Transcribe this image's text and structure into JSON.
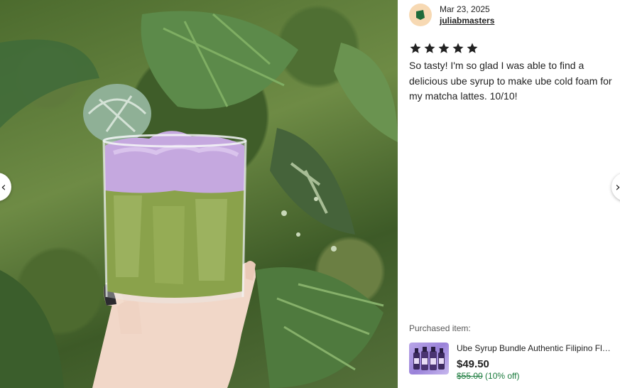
{
  "carousel": {
    "prev_icon": "chevron-left-icon",
    "next_icon": "chevron-right-icon"
  },
  "photo": {
    "icon": "review-photo"
  },
  "review": {
    "date": "Mar 23, 2025",
    "reviewer_name": "juliabmasters",
    "rating": 5,
    "rating_max": 5,
    "text": "So tasty! I'm so glad I was able to find a delicious ube syrup to make ube cold foam for my matcha lattes. 10/10!"
  },
  "purchased": {
    "label": "Purchased item:",
    "item_title": "Ube Syrup Bundle Authentic Filipino Flavor, Ube Syrup for Coffee",
    "price": "$49.50",
    "original_price": "$55.00",
    "discount": " (10% off)"
  },
  "colors": {
    "avatar_bg": "#f7d9b3",
    "avatar_icon": "#1e6b3a",
    "discount_green": "#1a7a3c",
    "star": "#222222"
  }
}
